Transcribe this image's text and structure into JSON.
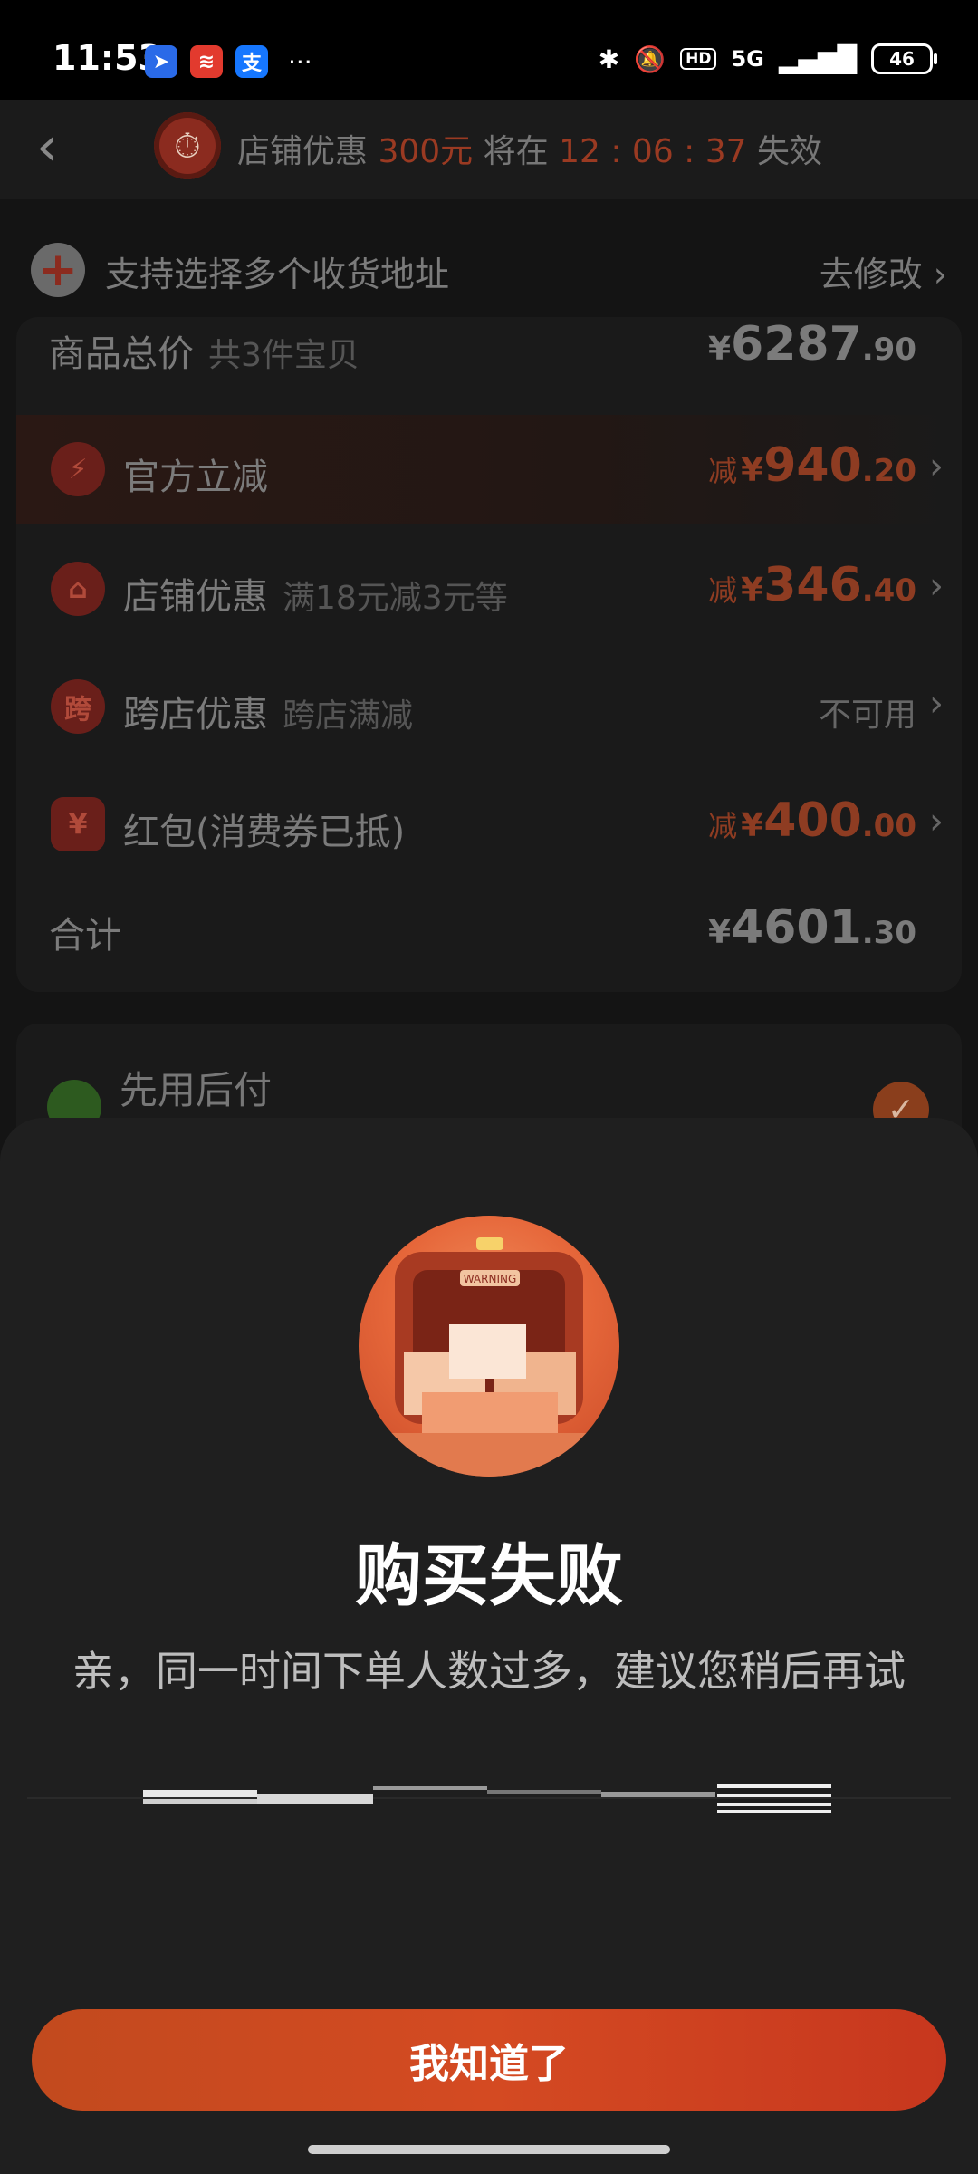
{
  "status_bar": {
    "time": "11:53",
    "app_icons": [
      "maps-icon",
      "chart-app-icon",
      "alipay-icon"
    ],
    "more": "···",
    "network": "5G",
    "hd": "HD",
    "battery": "46"
  },
  "timer": {
    "prefix": "店铺优惠",
    "amount": "300元",
    "middle": "将在",
    "countdown": "12 : 06 : 37",
    "suffix": "失效"
  },
  "address": {
    "label": "支持选择多个收货地址",
    "link": "去修改"
  },
  "summary": {
    "total": {
      "label": "商品总价",
      "sub": "共3件宝贝",
      "currency": "¥",
      "int": "6287",
      "dec": ".90"
    },
    "official": {
      "label": "官方立减",
      "icon": "lightning-icon",
      "prefix": "减",
      "currency": "¥",
      "int": "940",
      "dec": ".20"
    },
    "store": {
      "label": "店铺优惠",
      "sub": "满18元减3元等",
      "icon": "store-icon",
      "prefix": "减",
      "currency": "¥",
      "int": "346",
      "dec": ".40"
    },
    "cross": {
      "label": "跨店优惠",
      "sub": "跨店满减",
      "icon_text": "跨",
      "status": "不可用"
    },
    "redpacket": {
      "label": "红包(消费券已抵)",
      "icon": "red-packet-icon",
      "prefix": "减",
      "currency": "¥",
      "int": "400",
      "dec": ".00"
    },
    "grand": {
      "label": "合计",
      "currency": "¥",
      "int": "4601",
      "dec": ".30"
    }
  },
  "pay_later": {
    "label": "先用后付"
  },
  "dialog": {
    "title": "购买失败",
    "message": "亲，同一时间下单人数过多，建议您稍后再试",
    "illustration_text": "WARNING",
    "button": "我知道了"
  },
  "colors": {
    "accent": "#d44a22",
    "sheet_bg": "#1f1f1f",
    "overlay_bg": "#141414"
  }
}
